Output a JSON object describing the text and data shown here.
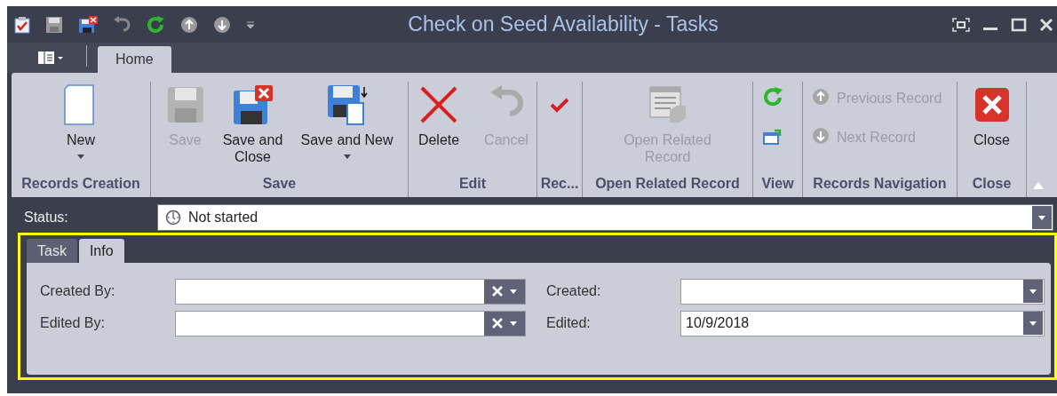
{
  "window": {
    "title": "Check on Seed Availability - Tasks"
  },
  "ribbon": {
    "tabs": [
      {
        "label": "Home",
        "selected": true
      }
    ],
    "groups": [
      {
        "label": "Records Creation",
        "buttons": [
          {
            "kind": "large",
            "label": "New",
            "disabled": false,
            "dropdown": true
          }
        ]
      },
      {
        "label": "Save",
        "buttons": [
          {
            "kind": "large",
            "label": "Save",
            "disabled": true,
            "dropdown": false
          },
          {
            "kind": "large",
            "label": "Save and Close",
            "disabled": false,
            "dropdown": false
          },
          {
            "kind": "large",
            "label": "Save and New",
            "disabled": false,
            "dropdown": true
          }
        ]
      },
      {
        "label": "Edit",
        "buttons": [
          {
            "kind": "large",
            "label": "Delete",
            "disabled": false,
            "dropdown": false
          },
          {
            "kind": "large",
            "label": "Cancel",
            "disabled": true,
            "dropdown": false
          }
        ]
      },
      {
        "label": "Rec...",
        "buttons": [
          {
            "kind": "large"
          }
        ]
      },
      {
        "label": "Open Related Record",
        "buttons": [
          {
            "kind": "large",
            "label": "Open Related Record",
            "disabled": true,
            "dropdown": false
          }
        ]
      },
      {
        "label": "View",
        "buttons": [
          {
            "kind": "small"
          },
          {
            "kind": "small"
          }
        ]
      },
      {
        "label": "Records Navigation",
        "buttons": [
          {
            "kind": "small",
            "label": "Previous Record",
            "disabled": true
          },
          {
            "kind": "small",
            "label": "Next Record",
            "disabled": true
          }
        ]
      },
      {
        "label": "Close",
        "buttons": [
          {
            "kind": "large",
            "label": "Close",
            "disabled": false,
            "dropdown": false
          }
        ]
      }
    ]
  },
  "status": {
    "label": "Status:",
    "value": "Not started"
  },
  "form_tabs": [
    {
      "label": "Task",
      "selected": false
    },
    {
      "label": "Info",
      "selected": true
    }
  ],
  "fields": [
    {
      "label": "Created By:",
      "kind": "lookup"
    },
    {
      "label": "Created:",
      "kind": "date"
    },
    {
      "label": "Edited By:",
      "kind": "lookup"
    },
    {
      "label": "Edited:",
      "kind": "date",
      "value": "10/9/2018"
    }
  ]
}
